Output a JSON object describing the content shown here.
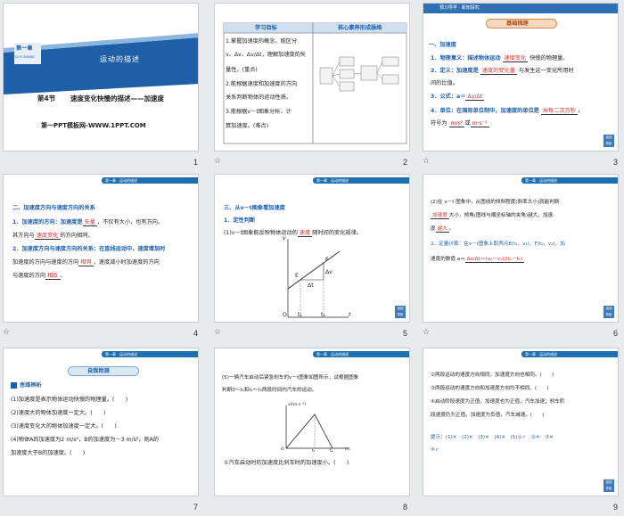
{
  "slides": {
    "s1": {
      "number": "1",
      "chapter_tag": "第一章",
      "chapter_sub": "DI YI ZHANG",
      "banner": "运动的描述",
      "section_label": "第4节",
      "section_title": "速度变化快慢的描述——加速度",
      "site": "第一PPT模板网-WWW.1PPT.COM"
    },
    "s2": {
      "number": "2",
      "col1_header": "学习目标",
      "col2_header": "核心素养形成脉络",
      "lines": [
        "1.掌握加速度的概念，能区分",
        "v、Δv、Δv/Δt，理解加速度的矢",
        "量性。(重点)",
        "2.能根据速度和加速度的方向",
        "关系判断物体的运动性质。",
        "3.能根据v－t图象分析、计",
        "算加速度。(难点)"
      ]
    },
    "s3": {
      "number": "3",
      "tab_label": "预习导学 · 新知探究",
      "badge": "基础梳理",
      "heading": "一、加速度",
      "items": [
        "1．物理意义：描述物体运动",
        "快慢的物理量。",
        "2．定义：加速度是",
        "与发生这一变化所用时",
        "间的比值。",
        "3．公式：a＝",
        "4．单位：在国际单位制中，加速度的单位是",
        "，",
        "符号为",
        "或"
      ],
      "blanks": [
        "速度变化",
        "速度的变化量",
        "Δv/Δt",
        "米每二次方秒",
        "m/s²",
        "m·s⁻²"
      ]
    },
    "s4": {
      "number": "4",
      "heading": "二、加速度方向与速度方向的关系",
      "lines": [
        "1．加速度的方向：加速度是",
        "，不仅有大小，也有方向。",
        "其方向与",
        "的方向相同。",
        "2．加速度方向与速度方向的关系：在直线运动中，速度增加时",
        "加速度的方向与速度的方向",
        "，速度减小时加速度的方向",
        "与速度的方向",
        "。"
      ],
      "blanks": [
        "矢量",
        "速度变化",
        "相同",
        "相反"
      ]
    },
    "s5": {
      "number": "5",
      "heading": "三、从v－t图象看加速度",
      "sub": "1．定性判断",
      "line": "(1)v－t图象能反映物体运动的",
      "line_end": "随时间的变化规律。",
      "blank": "速度",
      "graph_labels": [
        "v",
        "t",
        "O",
        "E",
        "F",
        "Δv",
        "Δt",
        "t₁",
        "t₂"
      ]
    },
    "s6": {
      "number": "6",
      "lines": [
        "(2)在 v－t 图象中，从图线的倾斜程度(斜率大小)就能判断",
        "大小，倾角(图线与横坐标轴的夹角)越大，加速",
        "度",
        "。",
        "2．定量计算：在v－t图象上取两点E(t₁，v₁)、F(t₂，v₂)，加",
        "速度的数值 a＝"
      ],
      "blanks": [
        "加速度",
        "越大"
      ],
      "formula": "Δv/Δt＝(v₂－v₁)/(t₂－t₁)"
    },
    "s7": {
      "number": "7",
      "badge": "自我检测",
      "sub": "思维辨析",
      "items": [
        "(1)加速度是表示物体运动快慢的物理量。(　　)",
        "(2)速度大的物体加速度一定大。(　　)",
        "(3)速度变化大的物体加速度一定大。(　　)",
        "(4)物体A的加速度为2 m/s²，B的加速度为－3 m/s²，则A的",
        "加速度大于B的加速度。(　　)"
      ]
    },
    "s8": {
      "number": "8",
      "lines": [
        "(5)一辆汽车启动后紧急刹车的v－t图象如图所示，试根据图象",
        "判断0～t₁和t₁～t₂两段时间内汽车的运动。"
      ],
      "graph_labels": [
        "v/(m·s⁻¹)",
        "t/s",
        "O",
        "t₁",
        "t₂"
      ],
      "q": "①汽车启动时的加速度比刹车时的加速度小。(　　)"
    },
    "s9": {
      "number": "9",
      "items": [
        "②两段运动的速度方向相同，加速度方向也相同。(　　)",
        "③两段运动的速度方向和加速度方向均不相同。(　　)",
        "④启动阶段速度为正值，加速度也为正值，汽车加速；刹车阶",
        "段速度仍为正值，加速度为负值，汽车减速。(　　)"
      ],
      "hint": "提示：(1)✕　(2)✕　(3)✕　(4)✕　(5)①✓　②✕　③✕",
      "hint2": "④✓"
    }
  }
}
